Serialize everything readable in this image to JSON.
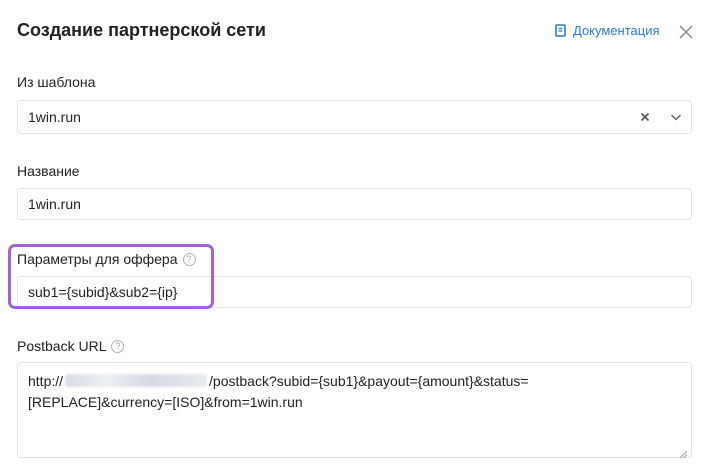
{
  "dialog": {
    "title": "Создание партнерской сети",
    "doc_link": "Документация"
  },
  "form": {
    "template": {
      "label": "Из шаблона",
      "value": "1win.run"
    },
    "name": {
      "label": "Название",
      "value": "1win.run"
    },
    "offer_params": {
      "label": "Параметры для оффера",
      "value": "sub1={subid}&sub2={ip}"
    },
    "postback": {
      "label": "Postback URL",
      "value_prefix": "http://",
      "value_line1_rest": "/postback?subid={sub1}&payout={amount}&status=",
      "value_line2": "[REPLACE]&currency=[ISO]&from=1win.run"
    }
  },
  "colors": {
    "accent": "#2b7bd1",
    "highlight": "#a062e0",
    "border": "#e3e3e3"
  },
  "icons": {
    "doc": "document-icon",
    "close": "close-icon",
    "clear": "clear-icon",
    "dropdown": "chevron-down-icon",
    "help": "help-circle-icon"
  }
}
